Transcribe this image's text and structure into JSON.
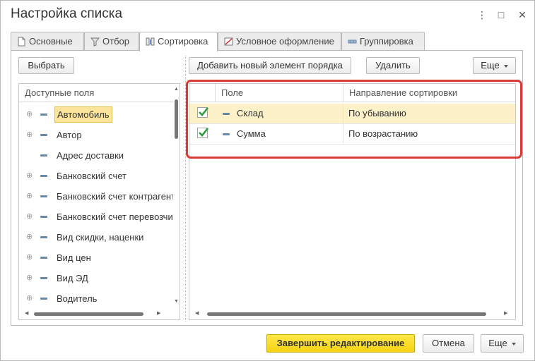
{
  "window": {
    "title": "Настройка списка",
    "controls": {
      "more": "⋮",
      "maximize": "□",
      "close": "✕"
    }
  },
  "tabs": [
    {
      "label": "Основные",
      "icon": "document-icon"
    },
    {
      "label": "Отбор",
      "icon": "filter-icon"
    },
    {
      "label": "Сортировка",
      "icon": "sort-icon",
      "active": true
    },
    {
      "label": "Условное оформление",
      "icon": "conditional-format-icon"
    },
    {
      "label": "Группировка",
      "icon": "grouping-icon"
    }
  ],
  "left_panel": {
    "select_button": "Выбрать",
    "header": "Доступные поля",
    "items": [
      {
        "label": "Автомобиль",
        "expandable": true,
        "selected": true
      },
      {
        "label": "Автор",
        "expandable": true
      },
      {
        "label": "Адрес доставки",
        "expandable": false
      },
      {
        "label": "Банковский счет",
        "expandable": true
      },
      {
        "label": "Банковский счет контрагента",
        "expandable": true
      },
      {
        "label": "Банковский счет перевозчика",
        "expandable": true
      },
      {
        "label": "Вид скидки, наценки",
        "expandable": true
      },
      {
        "label": "Вид цен",
        "expandable": true
      },
      {
        "label": "Вид ЭД",
        "expandable": true
      },
      {
        "label": "Водитель",
        "expandable": true
      }
    ]
  },
  "right_panel": {
    "add_button": "Добавить новый элемент порядка",
    "delete_button": "Удалить",
    "more_button": "Еще",
    "columns": {
      "field": "Поле",
      "direction": "Направление сортировки"
    },
    "rows": [
      {
        "checked": true,
        "field": "Склад",
        "direction": "По убыванию",
        "selected": true
      },
      {
        "checked": true,
        "field": "Сумма",
        "direction": "По возрастанию"
      }
    ]
  },
  "footer": {
    "finish_button": "Завершить редактирование",
    "cancel_button": "Отмена",
    "more_button": "Еще"
  },
  "colors": {
    "accent_yellow": "#f5d312",
    "highlight_red": "#dc3b35",
    "selection": "#fce49a",
    "checkmark": "#2e9e3e"
  }
}
